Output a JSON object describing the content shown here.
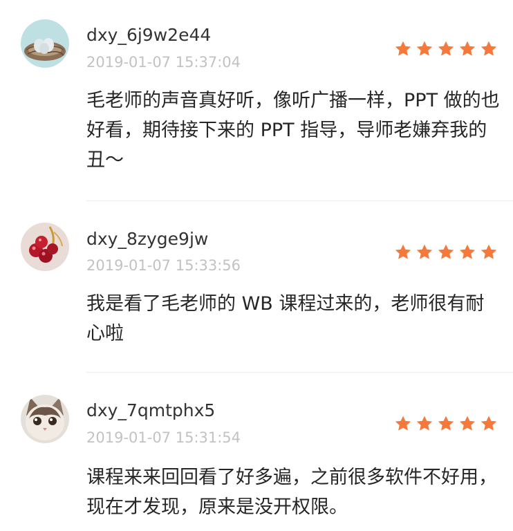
{
  "colors": {
    "star": "#f5793a",
    "username": "#333333",
    "timestamp": "#c2c2c2",
    "comment": "#262626",
    "divider": "#ececec"
  },
  "reviews": [
    {
      "username": "dxy_6j9w2e44",
      "timestamp": "2019-01-07 15:37:04",
      "rating": 5,
      "comment": "毛老师的声音真好听，像听广播一样，PPT 做的也好看，期待接下来的 PPT 指导，导师老嫌弃我的丑～",
      "avatar_icon": "bird-nest-eggs-avatar"
    },
    {
      "username": "dxy_8zyge9jw",
      "timestamp": "2019-01-07 15:33:56",
      "rating": 5,
      "comment": "我是看了毛老师的 WB 课程过来的，老师很有耐心啦",
      "avatar_icon": "red-berries-avatar"
    },
    {
      "username": "dxy_7qmtphx5",
      "timestamp": "2019-01-07 15:31:54",
      "rating": 5,
      "comment": "课程来来回回看了好多遍，之前很多软件不好用，现在才发现，原来是没开权限。",
      "avatar_icon": "kitten-avatar"
    }
  ]
}
